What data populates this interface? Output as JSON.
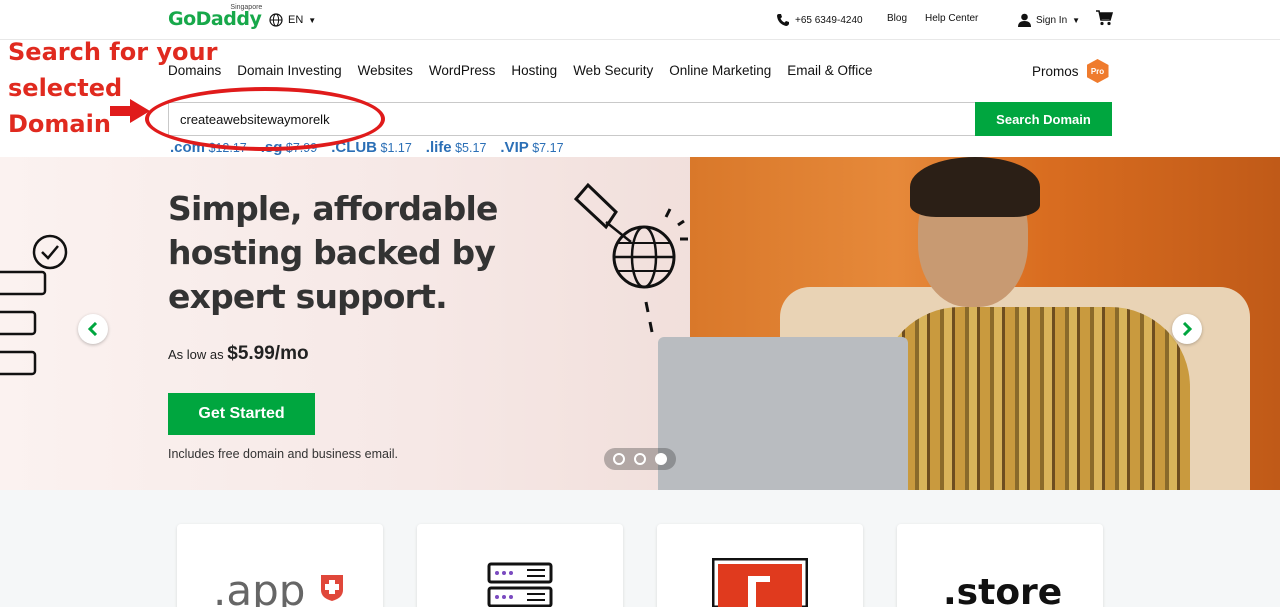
{
  "header": {
    "logo_text": "GoDaddy",
    "country": "Singapore",
    "language": "EN",
    "phone": "+65 6349-4240",
    "blog": "Blog",
    "help_center": "Help Center",
    "sign_in": "Sign In"
  },
  "nav": {
    "items": [
      "Domains",
      "Domain Investing",
      "Websites",
      "WordPress",
      "Hosting",
      "Web Security",
      "Online Marketing",
      "Email & Office"
    ],
    "promos": "Promos",
    "pro_badge": "Pro"
  },
  "search": {
    "value": "createawebsitewaymorelk",
    "button": "Search Domain"
  },
  "tlds": [
    {
      "name": ".com",
      "price": "$12.17"
    },
    {
      "name": ".sg",
      "price": "$7.99"
    },
    {
      "name": ".CLUB",
      "price": "$1.17"
    },
    {
      "name": ".life",
      "price": "$5.17"
    },
    {
      "name": ".VIP",
      "price": "$7.17"
    }
  ],
  "annotation": {
    "line1": "Search for your",
    "line2": "selected",
    "line3": "Domain"
  },
  "hero": {
    "title_line1": "Simple, affordable",
    "title_line2": "hosting backed by",
    "title_line3": "expert support.",
    "price_prefix": "As low as",
    "price": "$5.99/mo",
    "cta": "Get Started",
    "note": "Includes free domain and business email."
  },
  "cards": [
    {
      "label": ".app"
    },
    {
      "label": ""
    },
    {
      "label": ""
    },
    {
      "label": ".store"
    }
  ],
  "colors": {
    "brand_green": "#00a63f",
    "annotation_red": "#e02a1f",
    "tld_blue": "#2b6fb6",
    "promo_orange": "#ef7b2d"
  }
}
